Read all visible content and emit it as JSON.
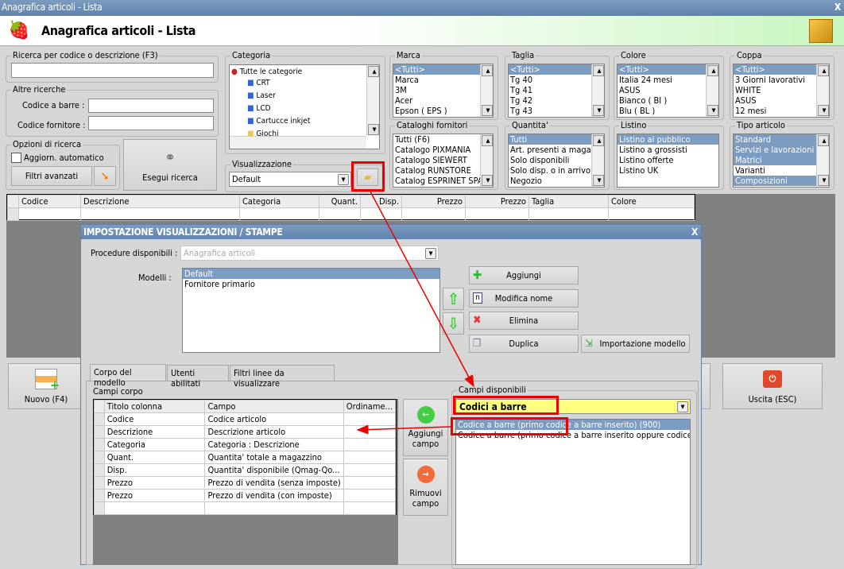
{
  "window": {
    "title": "Anagrafica articoli  - Lista",
    "close": "X"
  },
  "header": {
    "title": "Anagrafica articoli  - Lista"
  },
  "search": {
    "label": "Ricerca per codice o descrizione (F3)",
    "value": ""
  },
  "other": {
    "label": "Altre ricerche",
    "barcode_label": "Codice a barre :",
    "supplier_label": "Codice fornitore :"
  },
  "options": {
    "label": "Opzioni di ricerca",
    "auto_update": "Aggiorn. automatico",
    "advanced_filters": "Filtri avanzati",
    "run_search": "Esegui ricerca"
  },
  "categoria": {
    "label": "Categoria",
    "items": [
      "Tutte le categorie",
      "CRT",
      "Laser",
      "LCD",
      "Cartucce inkjet",
      "Giochi"
    ]
  },
  "visualizzazione": {
    "label": "Visualizzazione",
    "value": "Default"
  },
  "filters": [
    {
      "label": "Marca",
      "items": [
        "<Tutti>",
        "Marca",
        "3M",
        "Acer",
        "Epson ( EPS )"
      ]
    },
    {
      "label": "Taglia",
      "items": [
        "<Tutti>",
        "Tg 40",
        "Tg 41",
        "Tg 42",
        "Tg 43"
      ]
    },
    {
      "label": "Colore",
      "items": [
        "<Tutti>",
        "Italia 24 mesi",
        "ASUS",
        "Bianco ( BI )",
        "Blu ( BL )"
      ]
    },
    {
      "label": "Coppa",
      "items": [
        "<Tutti>",
        "3 Giorni lavorativi",
        "WHITE",
        "ASUS",
        "12 mesi"
      ]
    },
    {
      "label": "Cataloghi fornitori",
      "items": [
        "Tutti (F6)",
        "Catalogo PIXMANIA",
        "Catalogo SIEWERT",
        "Catalog RUNSTORE",
        "Catalog ESPRINET SPA"
      ]
    },
    {
      "label": "Quantita'",
      "items": [
        "Tutti",
        "Art. presenti a magazzino",
        "Solo disponibili",
        "Solo disp. o in arrivo",
        "Negozio"
      ]
    },
    {
      "label": "Listino",
      "items": [
        "Listino al pubblico",
        "Listino a grossisti",
        "Listino offerte",
        "Listino UK"
      ]
    },
    {
      "label": "Tipo articolo",
      "items": [
        "Standard",
        "Servizi e lavorazioni",
        "Matrici",
        "Varianti",
        "Composizioni"
      ]
    }
  ],
  "main_grid": {
    "columns": [
      "Codice",
      "Descrizione",
      "Categoria",
      "Quant.",
      "Disp.",
      "Prezzo",
      "Prezzo",
      "Taglia",
      "Colore"
    ]
  },
  "toolbar": {
    "new": "Nuovo (F4)",
    "exit": "Uscita (ESC)"
  },
  "dialog": {
    "title": "IMPOSTAZIONE VISUALIZZAZIONI / STAMPE",
    "close": "X",
    "procedure_label": "Procedure disponibili :",
    "procedure_value": "Anagrafica articoli",
    "models_label": "Modelli :",
    "models": [
      "Default",
      "Fornitore primario"
    ],
    "buttons": {
      "add": "Aggiungi",
      "rename": "Modifica nome",
      "delete": "Elimina",
      "duplicate": "Duplica",
      "import": "Importazione modello"
    },
    "tabs": [
      "Corpo del modello",
      "Utenti abilitati",
      "Filtri linee da visualizzare"
    ],
    "body_label": "Campi corpo",
    "body_columns": [
      "Titolo colonna",
      "Campo",
      "Ordiname..."
    ],
    "body_rows": [
      [
        "Codice",
        "Codice articolo",
        ""
      ],
      [
        "Descrizione",
        "Descrizione articolo",
        ""
      ],
      [
        "Categoria",
        "Categoria : Descrizione",
        ""
      ],
      [
        "Quant.",
        "Quantita' totale a magazzino",
        ""
      ],
      [
        "Disp.",
        "Quantita' disponibile (Qmag-Qo...",
        ""
      ],
      [
        "Prezzo",
        "Prezzo di vendita (senza imposte)",
        ""
      ],
      [
        "Prezzo",
        "Prezzo di vendita (con imposte)",
        ""
      ],
      [
        "",
        "",
        ""
      ]
    ],
    "add_field": "Aggiungi campo",
    "remove_field": "Rimuovi campo",
    "available_label": "Campi disponibili",
    "available_group": "Codici a barre",
    "available_items": [
      "Codice a barre (primo codice a barre inserito) (900)",
      "Codice a barre (primo codice a barre inserito oppure codice interno)"
    ]
  },
  "colors": {
    "selection": "#7c9cc2",
    "title": "#6a8bb4",
    "highlight": "#ffff80",
    "annotation": "#ee0000"
  }
}
